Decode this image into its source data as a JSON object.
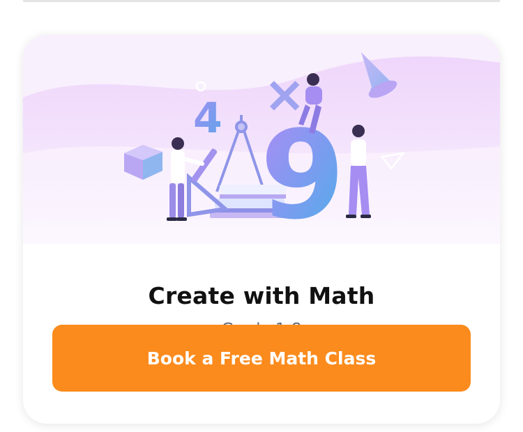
{
  "course": {
    "title": "Create with Math",
    "grade": "Grade 1-8",
    "cta_label": "Book a Free Math Class"
  },
  "illustration": {
    "digits": [
      "4",
      "9"
    ],
    "symbol": "×"
  },
  "colors": {
    "cta": "#fb8b1d",
    "hero_bg": "#f1dcfb",
    "title": "#111111",
    "grade": "#5c6878"
  }
}
